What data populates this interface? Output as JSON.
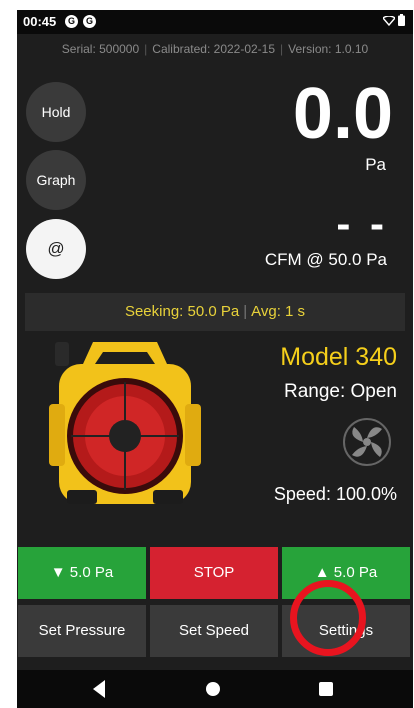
{
  "status_bar": {
    "time": "00:45",
    "notification_icons": [
      "G",
      "G"
    ],
    "wifi_icon": "wifi-icon",
    "battery_icon": "battery-icon"
  },
  "info_bar": {
    "serial": "Serial: 500000",
    "calibrated": "Calibrated: 2022-02-15",
    "version": "Version: 1.0.10"
  },
  "side_buttons": {
    "hold": "Hold",
    "graph": "Graph",
    "at": "@"
  },
  "reading": {
    "pressure_value": "0.0",
    "pressure_unit": "Pa",
    "flow_value": "- -",
    "flow_label": "CFM @ 50.0 Pa"
  },
  "seek_bar": {
    "seeking": "Seeking: 50.0 Pa",
    "avg": "Avg: 1 s"
  },
  "device": {
    "model": "Model 340",
    "range": "Range: Open",
    "speed": "Speed: 100.0%"
  },
  "controls": {
    "decrease": "▼ 5.0 Pa",
    "stop": "STOP",
    "increase": "▲ 5.0 Pa",
    "set_pressure": "Set Pressure",
    "set_speed": "Set Speed",
    "settings": "Settings"
  },
  "colors": {
    "accent_yellow": "#f5cf1b",
    "seek_text": "#e8d23a",
    "green": "#27a33a",
    "red": "#d52230",
    "highlight_ring": "#e8141f"
  }
}
